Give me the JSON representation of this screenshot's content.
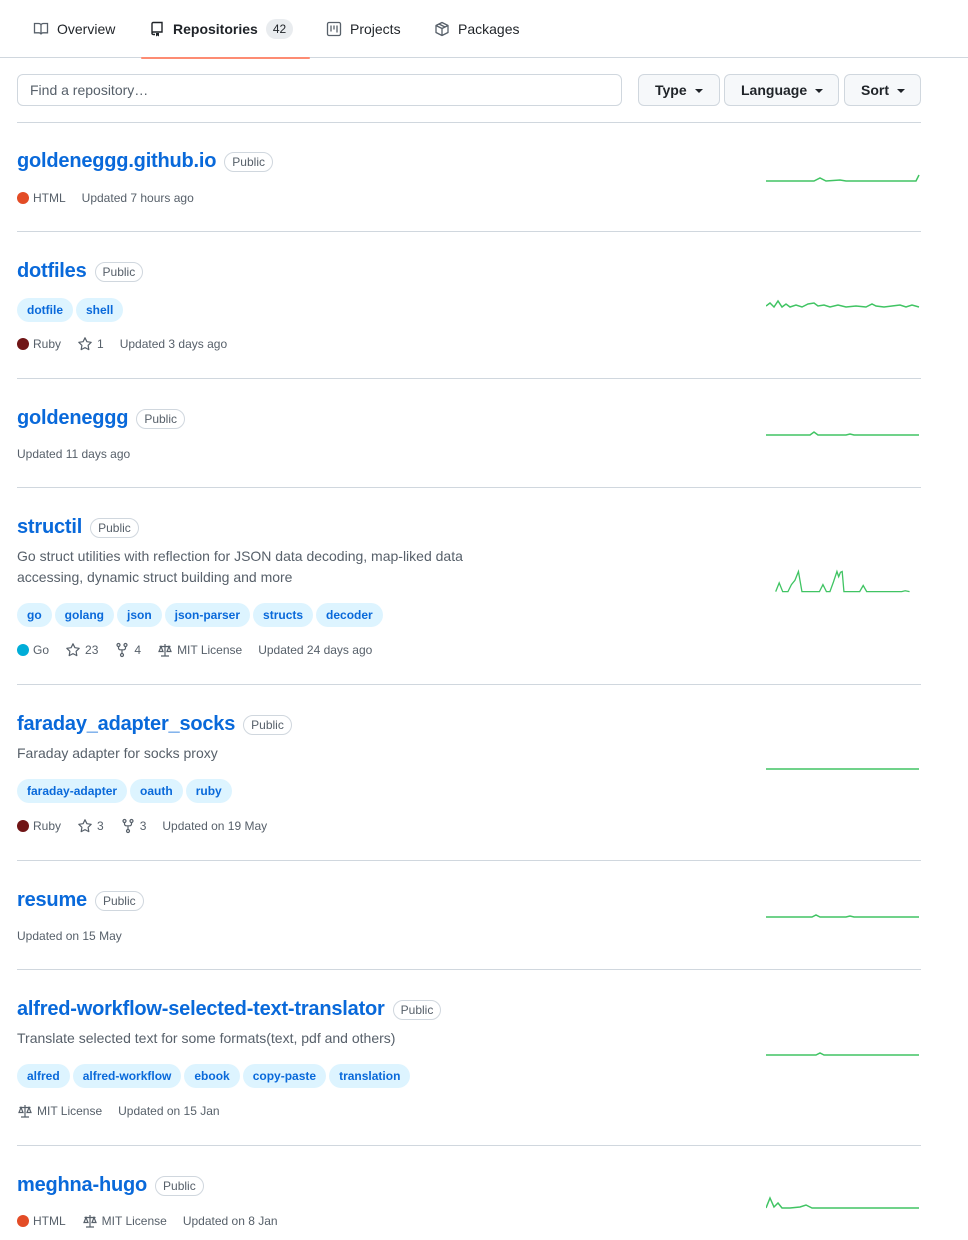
{
  "tabs": [
    {
      "label": "Overview",
      "icon": "book-icon"
    },
    {
      "label": "Repositories",
      "icon": "repo-icon",
      "count": "42",
      "selected": true
    },
    {
      "label": "Projects",
      "icon": "project-icon"
    },
    {
      "label": "Packages",
      "icon": "package-icon"
    }
  ],
  "search": {
    "placeholder": "Find a repository…"
  },
  "filters": {
    "type": "Type",
    "language": "Language",
    "sort": "Sort"
  },
  "colors": {
    "accent": "#0969da",
    "tab_underline": "#fd8c73",
    "spark": "#40c463",
    "html": "#e34c26",
    "ruby": "#701516",
    "go": "#00add8"
  },
  "repos": [
    {
      "name": "goldeneggg.github.io",
      "visibility": "Public",
      "language": "HTML",
      "language_color": "#e34c26",
      "updated": "Updated 7 hours ago"
    },
    {
      "name": "dotfiles",
      "visibility": "Public",
      "topics": [
        "dotfile",
        "shell"
      ],
      "language": "Ruby",
      "language_color": "#701516",
      "stars": "1",
      "updated": "Updated 3 days ago"
    },
    {
      "name": "goldeneggg",
      "visibility": "Public",
      "updated": "Updated 11 days ago"
    },
    {
      "name": "structil",
      "visibility": "Public",
      "description_line1": "Go struct utilities with reflection for JSON data decoding, map-liked data",
      "description_line2": "accessing, dynamic struct building and more",
      "topics": [
        "go",
        "golang",
        "json",
        "json-parser",
        "structs",
        "decoder"
      ],
      "language": "Go",
      "language_color": "#00add8",
      "stars": "23",
      "forks": "4",
      "license": "MIT License",
      "updated": "Updated 24 days ago"
    },
    {
      "name": "faraday_adapter_socks",
      "visibility": "Public",
      "description": "Faraday adapter for socks proxy",
      "topics": [
        "faraday-adapter",
        "oauth",
        "ruby"
      ],
      "language": "Ruby",
      "language_color": "#701516",
      "stars": "3",
      "forks": "3",
      "updated": "Updated on 19 May"
    },
    {
      "name": "resume",
      "visibility": "Public",
      "updated": "Updated on 15 May"
    },
    {
      "name": "alfred-workflow-selected-text-translator",
      "visibility": "Public",
      "description": "Translate selected text for some formats(text, pdf and others)",
      "topics": [
        "alfred",
        "alfred-workflow",
        "ebook",
        "copy-paste",
        "translation"
      ],
      "license": "MIT License",
      "updated": "Updated on 15 Jan"
    },
    {
      "name": "meghna-hugo",
      "visibility": "Public",
      "language": "HTML",
      "language_color": "#e34c26",
      "license": "MIT License",
      "updated": "Updated on 8 Jan"
    }
  ]
}
